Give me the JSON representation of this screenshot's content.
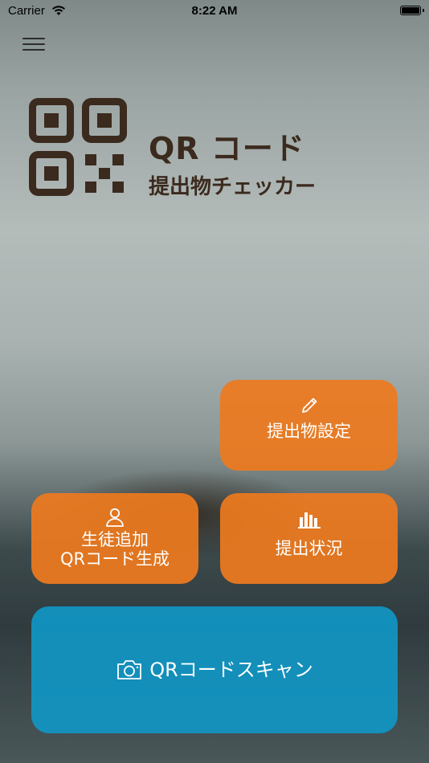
{
  "status_bar": {
    "carrier": "Carrier",
    "time": "8:22 AM",
    "battery_level": 1.0
  },
  "app_title": {
    "line1": "QR コード",
    "line2": "提出物チェッカー"
  },
  "buttons": {
    "submission_settings": "提出物設定",
    "add_student_line1": "生徒追加",
    "add_student_line2": "QRコード生成",
    "submission_status": "提出状況",
    "qr_scan": "QRコードスキャン"
  },
  "colors": {
    "orange_button": "#ED7A1E",
    "blue_button": "#1096C4",
    "title_brown": "#3B2A1E"
  },
  "icons": [
    "menu-icon",
    "qr-logo-icon",
    "pencil-icon",
    "person-icon",
    "bar-chart-icon",
    "camera-icon",
    "wifi-icon",
    "battery-icon"
  ]
}
